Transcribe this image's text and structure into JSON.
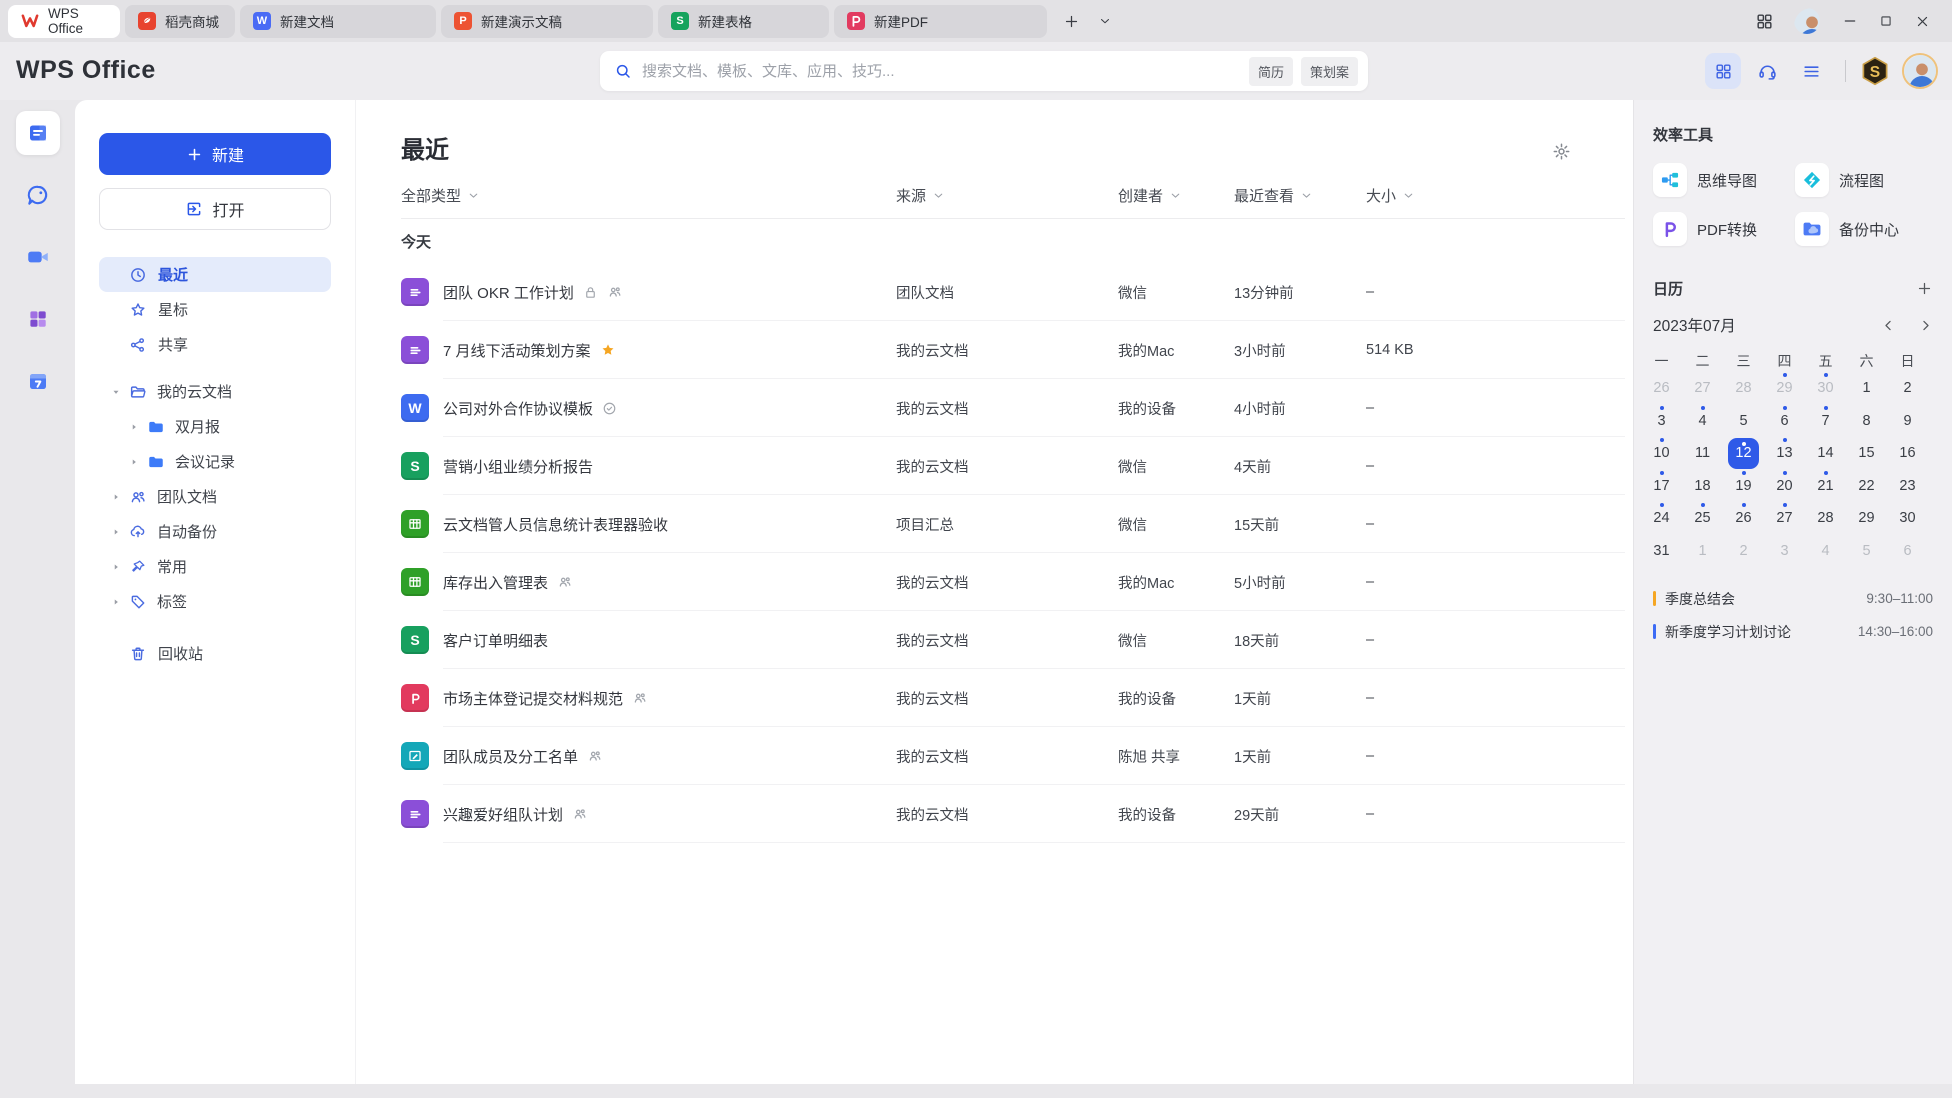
{
  "tab_bar": {
    "tabs": [
      {
        "id": "wps-home",
        "label": "WPS Office",
        "icon": "wps-logo",
        "active": true
      },
      {
        "id": "docer-store",
        "label": "稻壳商城",
        "icon": "docer",
        "active": false
      },
      {
        "id": "new-doc",
        "label": "新建文档",
        "icon": "letter",
        "letter": "W",
        "color": "#4A6BF5",
        "active": false
      },
      {
        "id": "new-ppt",
        "label": "新建演示文稿",
        "icon": "letter",
        "letter": "P",
        "color": "#ED5333",
        "active": false
      },
      {
        "id": "new-sheet",
        "label": "新建表格",
        "icon": "letter",
        "letter": "S",
        "color": "#15A35D",
        "active": false
      },
      {
        "id": "new-pdf",
        "label": "新建PDF",
        "icon": "pdf-tab",
        "letter": "P",
        "color": "#E23B60",
        "active": false
      }
    ]
  },
  "header": {
    "logo_text": "WPS Office",
    "search": {
      "placeholder": "搜索文档、模板、文库、应用、技巧...",
      "tags": [
        "简历",
        "策划案"
      ]
    },
    "vip_badge_letter": "S"
  },
  "sidebar": {
    "new_button_label": "新建",
    "open_button_label": "打开",
    "nav": [
      {
        "label": "最近",
        "icon": "clock",
        "active": true
      },
      {
        "label": "星标",
        "icon": "star",
        "active": false
      },
      {
        "label": "共享",
        "icon": "share",
        "active": false
      }
    ],
    "tree": [
      {
        "label": "我的云文档",
        "icon": "folder-open",
        "level": 0,
        "expanded": true
      },
      {
        "label": "双月报",
        "icon": "folder",
        "level": 1,
        "expanded": false
      },
      {
        "label": "会议记录",
        "icon": "folder",
        "level": 1,
        "expanded": false
      },
      {
        "label": "团队文档",
        "icon": "team",
        "level": 0,
        "expanded": false
      },
      {
        "label": "自动备份",
        "icon": "cloud-backup",
        "level": 0,
        "expanded": false
      },
      {
        "label": "常用",
        "icon": "pin",
        "level": 0,
        "expanded": false
      },
      {
        "label": "标签",
        "icon": "tag",
        "level": 0,
        "expanded": false
      }
    ],
    "trash_label": "回收站"
  },
  "main": {
    "title": "最近",
    "filters": [
      "全部类型",
      "来源",
      "创建者",
      "最近查看",
      "大小"
    ],
    "group_label": "今天",
    "rows": [
      {
        "name": "团队 OKR 工作计划",
        "type": "doc_purple",
        "glyph": "doclines",
        "badges": [
          "lock",
          "members"
        ],
        "source": "团队文档",
        "creator": "微信",
        "viewed": "13分钟前",
        "size": "–"
      },
      {
        "name": "7 月线下活动策划方案",
        "type": "doc_purple",
        "glyph": "doclines",
        "badges": [
          "star"
        ],
        "source": "我的云文档",
        "creator": "我的Mac",
        "viewed": "3小时前",
        "size": "514 KB"
      },
      {
        "name": "公司对外合作协议模板",
        "type": "doc_blue",
        "glyph": "letter",
        "letter": "W",
        "badges": [
          "shield"
        ],
        "source": "我的云文档",
        "creator": "我的设备",
        "viewed": "4小时前",
        "size": "–"
      },
      {
        "name": "营销小组业绩分析报告",
        "type": "sheet_green",
        "glyph": "letter",
        "letter": "S",
        "badges": [],
        "source": "我的云文档",
        "creator": "微信",
        "viewed": "4天前",
        "size": "–"
      },
      {
        "name": "云文档管人员信息统计表理器验收",
        "type": "table_green",
        "glyph": "table",
        "badges": [],
        "source": "项目汇总",
        "creator": "微信",
        "viewed": "15天前",
        "size": "–"
      },
      {
        "name": "库存出入管理表",
        "type": "table_green",
        "glyph": "table",
        "badges": [
          "members"
        ],
        "source": "我的云文档",
        "creator": "我的Mac",
        "viewed": "5小时前",
        "size": "–"
      },
      {
        "name": "客户订单明细表",
        "type": "sheet_green",
        "glyph": "letter",
        "letter": "S",
        "badges": [],
        "source": "我的云文档",
        "creator": "微信",
        "viewed": "18天前",
        "size": "–"
      },
      {
        "name": "市场主体登记提交材料规范",
        "type": "pdf_red",
        "glyph": "pdfp",
        "letter": "P",
        "badges": [
          "members"
        ],
        "source": "我的云文档",
        "creator": "我的设备",
        "viewed": "1天前",
        "size": "–"
      },
      {
        "name": "团队成员及分工名单",
        "type": "form_teal",
        "glyph": "form",
        "badges": [
          "members"
        ],
        "source": "我的云文档",
        "creator": "陈旭 共享",
        "viewed": "1天前",
        "size": "–"
      },
      {
        "name": "兴趣爱好组队计划",
        "type": "doc_purple",
        "glyph": "doclines",
        "badges": [
          "members"
        ],
        "source": "我的云文档",
        "creator": "我的设备",
        "viewed": "29天前",
        "size": "–"
      }
    ]
  },
  "right_panel": {
    "tools_title": "效率工具",
    "tools": [
      {
        "label": "思维导图",
        "icon": "mindmap"
      },
      {
        "label": "流程图",
        "icon": "flowchart"
      },
      {
        "label": "PDF转换",
        "icon": "pdf-convert"
      },
      {
        "label": "备份中心",
        "icon": "backup-center"
      }
    ],
    "calendar": {
      "title": "日历",
      "month_label": "2023年07月",
      "weekdays": [
        "一",
        "二",
        "三",
        "四",
        "五",
        "六",
        "日"
      ],
      "days": [
        {
          "d": 26,
          "muted": true
        },
        {
          "d": 27,
          "muted": true
        },
        {
          "d": 28,
          "muted": true
        },
        {
          "d": 29,
          "muted": true,
          "dot": true
        },
        {
          "d": 30,
          "muted": true,
          "dot": true
        },
        {
          "d": 1
        },
        {
          "d": 2
        },
        {
          "d": 3,
          "dot": true
        },
        {
          "d": 4,
          "dot": true
        },
        {
          "d": 5
        },
        {
          "d": 6,
          "dot": true
        },
        {
          "d": 7,
          "dot": true
        },
        {
          "d": 8
        },
        {
          "d": 9
        },
        {
          "d": 10,
          "dot": true
        },
        {
          "d": 11
        },
        {
          "d": 12,
          "selected": true,
          "dot": true
        },
        {
          "d": 13,
          "dot": true
        },
        {
          "d": 14
        },
        {
          "d": 15
        },
        {
          "d": 16
        },
        {
          "d": 17,
          "dot": true
        },
        {
          "d": 18
        },
        {
          "d": 19,
          "dot": true
        },
        {
          "d": 20,
          "dot": true
        },
        {
          "d": 21,
          "dot": true
        },
        {
          "d": 22
        },
        {
          "d": 23
        },
        {
          "d": 24,
          "dot": true
        },
        {
          "d": 25,
          "dot": true
        },
        {
          "d": 26,
          "dot": true
        },
        {
          "d": 27,
          "dot": true
        },
        {
          "d": 28
        },
        {
          "d": 29
        },
        {
          "d": 30
        },
        {
          "d": 31
        },
        {
          "d": 1,
          "muted": true
        },
        {
          "d": 2,
          "muted": true
        },
        {
          "d": 3,
          "muted": true
        },
        {
          "d": 4,
          "muted": true
        },
        {
          "d": 5,
          "muted": true
        },
        {
          "d": 6,
          "muted": true
        }
      ],
      "events": [
        {
          "title": "季度总结会",
          "time": "9:30–11:00",
          "color": "#F5A623"
        },
        {
          "title": "新季度学习计划讨论",
          "time": "14:30–16:00",
          "color": "#3D6BF5"
        }
      ]
    }
  },
  "colors": {
    "accent_blue": "#2B57E8",
    "doc_purple": "#8B4FD8",
    "doc_blue": "#3D6BF0",
    "sheet_green": "#18A05F",
    "table_green": "#2FA028",
    "pdf_red": "#E23A5E",
    "form_teal": "#14A7B8",
    "selected_day_blue": "#2F5AE8",
    "star_gold": "#F5A623"
  }
}
